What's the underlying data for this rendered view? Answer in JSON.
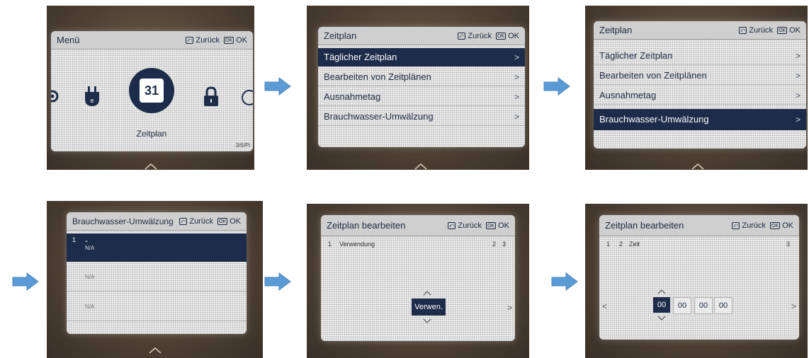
{
  "colors": {
    "selection": "#1d2c4a",
    "arrow": "#5b9bd5",
    "screen": "#ececec",
    "header": "#cfcfcf"
  },
  "panel1": {
    "title": "Menü",
    "back": "Zurück",
    "ok": "OK",
    "back_icon": "back-key-icon",
    "ok_icon_text": "OK",
    "center_number": "31",
    "center_label": "Zeitplan",
    "corner": "3/6/Pi"
  },
  "panel2": {
    "title": "Zeitplan",
    "back": "Zurück",
    "ok": "OK",
    "ok_icon_text": "OK",
    "items": [
      {
        "label": "Täglicher Zeitplan",
        "chev": ">"
      },
      {
        "label": "Bearbeiten von Zeitplänen",
        "chev": ">"
      },
      {
        "label": "Ausnahmetag",
        "chev": ">"
      },
      {
        "label": "Brauchwasser-Umwälzung",
        "chev": ">"
      }
    ]
  },
  "panel3": {
    "title": "Zeitplan",
    "back": "Zurück",
    "ok": "OK",
    "ok_icon_text": "OK",
    "items": [
      {
        "label": "Täglicher Zeitplan",
        "chev": ">"
      },
      {
        "label": "Bearbeiten von Zeitplänen",
        "chev": ">"
      },
      {
        "label": "Ausnahmetag",
        "chev": ">"
      },
      {
        "label": "Brauchwasser-Umwälzung",
        "chev": ">"
      }
    ]
  },
  "panel4": {
    "title": "Brauchwasser-Umwälzung",
    "back": "Zurück",
    "ok": "OK",
    "ok_icon_text": "OK",
    "rows": [
      {
        "index": "1",
        "dash": "-",
        "value": "N/A"
      },
      {
        "index": "",
        "dash": "",
        "value": "N/A"
      },
      {
        "index": "",
        "dash": "",
        "value": "N/A"
      }
    ]
  },
  "panel5": {
    "title": "Zeitplan bearbeiten",
    "back": "Zurück",
    "ok": "OK",
    "ok_icon_text": "OK",
    "step": "1",
    "field": "Verwendung",
    "page_a": "2",
    "page_b": "3",
    "button": "Verwen.",
    "right_chev": ">"
  },
  "panel6": {
    "title": "Zeitplan bearbeiten",
    "back": "Zurück",
    "ok": "OK",
    "ok_icon_text": "OK",
    "step_a": "1",
    "step_b": "2",
    "field": "Zeit",
    "page": "3",
    "time_fields": [
      "00",
      "00",
      "00",
      "00"
    ],
    "left_chev": "<",
    "right_chev": ">"
  }
}
